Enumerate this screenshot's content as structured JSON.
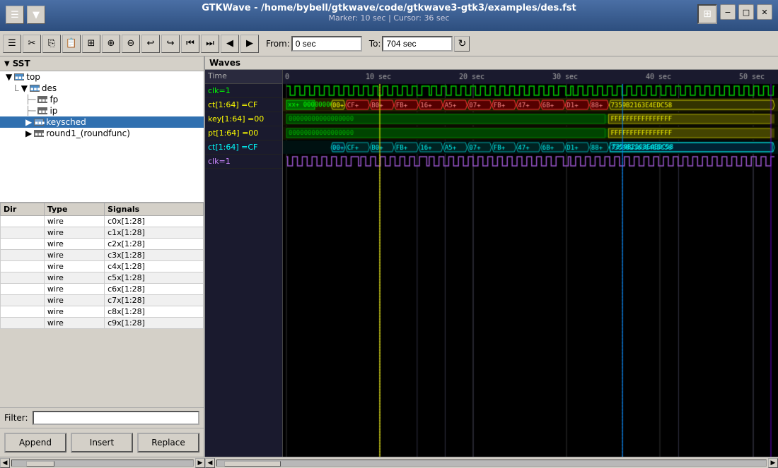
{
  "titlebar": {
    "title": "GTKWave - /home/bybell/gtkwave/code/gtkwave3-gtk3/examples/des.fst",
    "subtitle": "Marker: 10 sec  |  Cursor: 36 sec",
    "minimize_label": "−",
    "maximize_label": "□",
    "close_label": "✕"
  },
  "toolbar": {
    "from_label": "From:",
    "from_value": "0 sec",
    "to_label": "To:",
    "to_value": "704 sec"
  },
  "sst": {
    "header": "SST",
    "tree": [
      {
        "label": "top",
        "level": 0,
        "type": "module",
        "expanded": true,
        "icon": "▼"
      },
      {
        "label": "des",
        "level": 1,
        "type": "module",
        "expanded": true,
        "icon": "▼"
      },
      {
        "label": "fp",
        "level": 2,
        "type": "module",
        "icon": ""
      },
      {
        "label": "ip",
        "level": 2,
        "type": "module",
        "icon": ""
      },
      {
        "label": "keysched",
        "level": 2,
        "type": "module",
        "selected": true,
        "icon": "▶"
      },
      {
        "label": "round1_(roundfunc)",
        "level": 2,
        "type": "module",
        "icon": ""
      }
    ]
  },
  "signals_table": {
    "headers": [
      "Dir",
      "Type",
      "Signals"
    ],
    "rows": [
      [
        "",
        "wire",
        "c0x[1:28]"
      ],
      [
        "",
        "wire",
        "c1x[1:28]"
      ],
      [
        "",
        "wire",
        "c2x[1:28]"
      ],
      [
        "",
        "wire",
        "c3x[1:28]"
      ],
      [
        "",
        "wire",
        "c4x[1:28]"
      ],
      [
        "",
        "wire",
        "c5x[1:28]"
      ],
      [
        "",
        "wire",
        "c6x[1:28]"
      ],
      [
        "",
        "wire",
        "c7x[1:28]"
      ],
      [
        "",
        "wire",
        "c8x[1:28]"
      ],
      [
        "",
        "wire",
        "c9x[1:28]"
      ]
    ]
  },
  "filter": {
    "label": "Filter:",
    "placeholder": ""
  },
  "buttons": {
    "append": "Append",
    "insert": "Insert",
    "replace": "Replace"
  },
  "waves": {
    "header": "Waves",
    "time_label": "Time",
    "time_markers": [
      "0",
      "10 sec",
      "20 sec",
      "30 sec",
      "40 sec",
      "50 sec"
    ],
    "signals": [
      {
        "name": "clk=1",
        "color": "green",
        "type": "clock"
      },
      {
        "name": "ct[1:64] =CF",
        "color": "yellow",
        "type": "bus"
      },
      {
        "name": "key[1:64] =00",
        "color": "yellow",
        "type": "bus"
      },
      {
        "name": "pt[1:64] =00",
        "color": "yellow",
        "type": "bus"
      },
      {
        "name": "ct[1:64] =CF",
        "color": "cyan",
        "type": "bus"
      },
      {
        "name": "clk=1",
        "color": "purple",
        "type": "clock"
      }
    ]
  }
}
